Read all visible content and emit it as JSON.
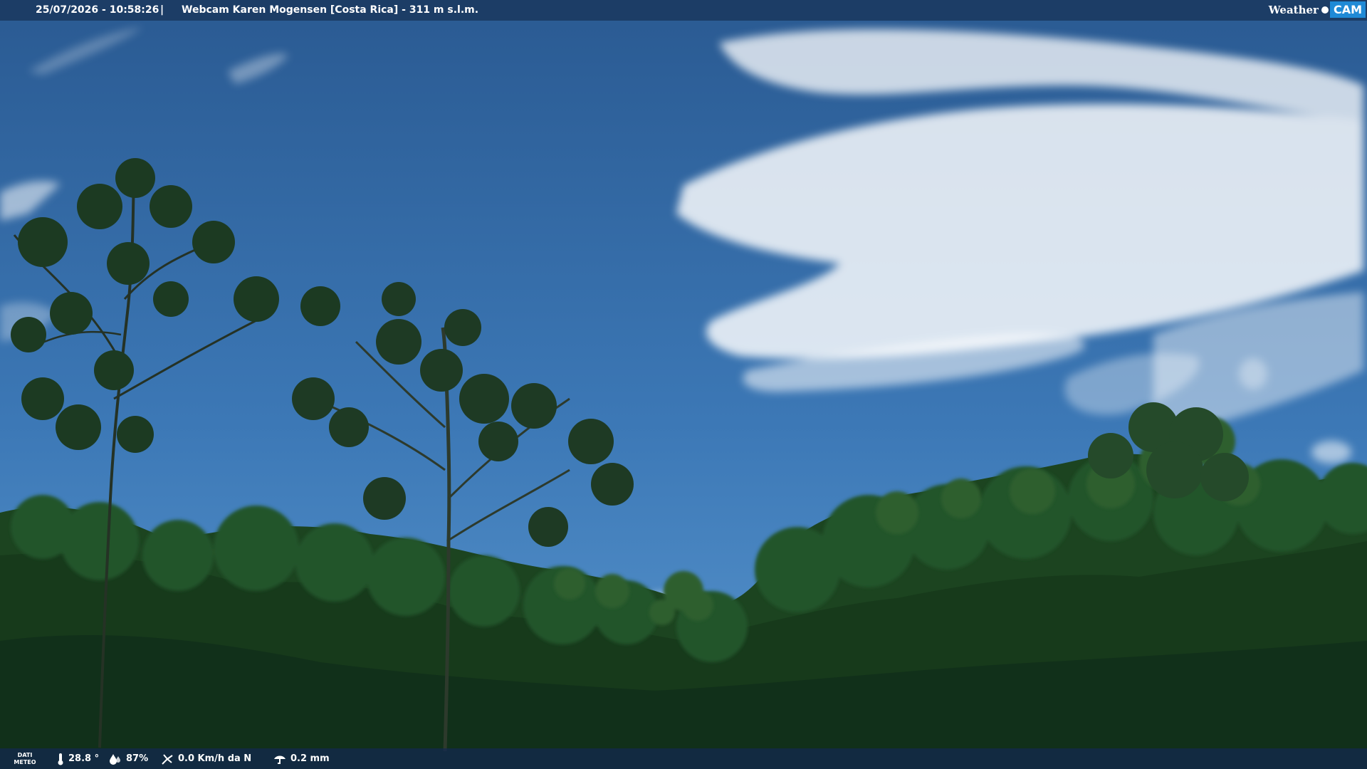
{
  "header": {
    "datetime": "25/07/2026 - 10:58:26",
    "separator": "|",
    "title": "Webcam Karen Mogensen [Costa Rica]  - 311 m s.l.m."
  },
  "logo": {
    "weather": "Weather",
    "cam": "CAM"
  },
  "footer": {
    "meteo_label_1": "DATI",
    "meteo_label_2": "METEO",
    "temperature": "28.8 °",
    "humidity": "87%",
    "wind": "0.0 Km/h da N",
    "rain": "0.2 mm"
  },
  "icons": {
    "temperature": "thermometer-icon",
    "humidity": "droplets-icon",
    "wind": "wind-icon",
    "rain": "rain-gauge-icon"
  },
  "colors": {
    "sky_top": "#2a5a92",
    "sky_bottom": "#4f8fcc",
    "forest_dark": "#0f2a14",
    "forest_mid": "#1f4a22",
    "bar": "#18345a"
  }
}
